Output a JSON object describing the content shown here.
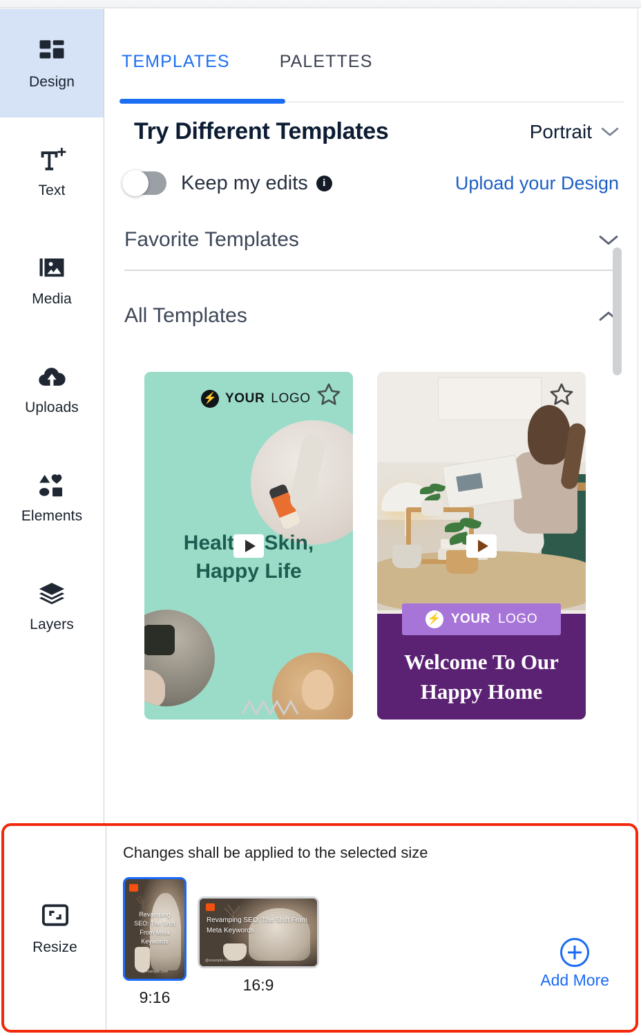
{
  "sidebar": {
    "items": [
      {
        "label": "Design",
        "icon": "grid-icon",
        "active": true
      },
      {
        "label": "Text",
        "icon": "text-add-icon",
        "active": false
      },
      {
        "label": "Media",
        "icon": "image-icon",
        "active": false
      },
      {
        "label": "Uploads",
        "icon": "upload-icon",
        "active": false
      },
      {
        "label": "Elements",
        "icon": "shapes-icon",
        "active": false
      },
      {
        "label": "Layers",
        "icon": "layers-icon",
        "active": false
      }
    ],
    "active_color": "#d6e3f7"
  },
  "tabs": [
    {
      "label": "TEMPLATES",
      "active": true
    },
    {
      "label": "PALETTES",
      "active": false
    }
  ],
  "header": {
    "title": "Try Different Templates",
    "orientation_selected": "Portrait",
    "orientation_caret": "chevron-down-icon"
  },
  "controls": {
    "keep_edits_label": "Keep my edits",
    "keep_edits_on": false,
    "info_icon": "info-icon",
    "upload_link": "Upload your Design"
  },
  "sections": [
    {
      "title": "Favorite Templates",
      "expanded": false,
      "caret": "chevron-down-icon"
    },
    {
      "title": "All Templates",
      "expanded": true,
      "caret": "chevron-up-icon"
    }
  ],
  "templates": [
    {
      "logo_your": "YOUR",
      "logo_logo": "LOGO",
      "headline_line1": "Healthy Skin,",
      "headline_line2": "Happy Life",
      "background": "#9bdcc9",
      "text_color": "#1d5c4f",
      "favorited": false,
      "star_icon": "star-outline-icon",
      "play_icon": "play-icon"
    },
    {
      "logo_your": "YOUR",
      "logo_logo": "LOGO",
      "headline_line1": "Welcome To Our",
      "headline_line2": "Happy Home",
      "background": "#5b2273",
      "chip_color": "#a775d8",
      "text_color": "#ffffff",
      "favorited": false,
      "star_icon": "star-outline-icon",
      "play_icon": "play-icon"
    }
  ],
  "resize_panel": {
    "rail_label": "Resize",
    "rail_icon": "resize-icon",
    "note": "Changes shall be applied to the selected size",
    "highlight_color": "#f4290c",
    "sizes": [
      {
        "ratio": "9:16",
        "selected": true,
        "thumb_text": "Revamping SEO: The Shift From Meta Keywords",
        "thumb_url": "@example.com"
      },
      {
        "ratio": "16:9",
        "selected": false,
        "thumb_text": "Revamping SEO: The Shift From Meta Keywords",
        "thumb_url": "@example.com"
      }
    ],
    "add_more_label": "Add More",
    "add_more_icon": "plus-circle-icon"
  }
}
